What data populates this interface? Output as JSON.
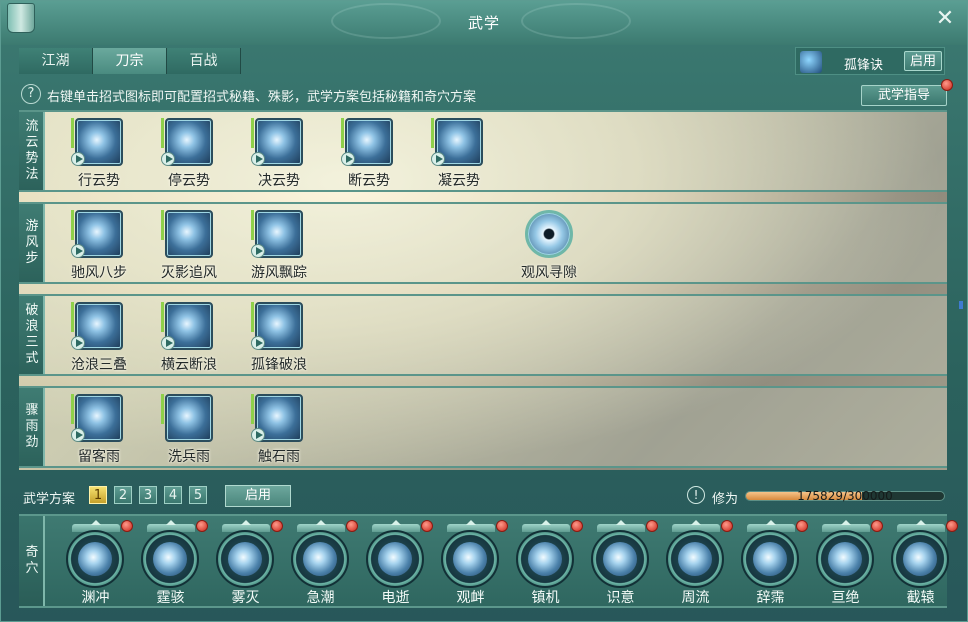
{
  "window": {
    "title": "武学"
  },
  "tabs": [
    {
      "label": "江湖",
      "active": false
    },
    {
      "label": "刀宗",
      "active": true
    },
    {
      "label": "百战",
      "active": false
    }
  ],
  "current_skill": {
    "name": "孤锋诀",
    "enable_label": "启用"
  },
  "hint": {
    "text": "右键单击招式图标即可配置招式秘籍、殊影，武学方案包括秘籍和奇穴方案"
  },
  "guide_button": {
    "label": "武学指导"
  },
  "categories": [
    {
      "label": [
        "流",
        "云",
        "势",
        "法"
      ],
      "moves": [
        {
          "name": "行云势",
          "kind": "square",
          "playable": true
        },
        {
          "name": "停云势",
          "kind": "square",
          "playable": true
        },
        {
          "name": "决云势",
          "kind": "square",
          "playable": true
        },
        {
          "name": "断云势",
          "kind": "square",
          "playable": true
        },
        {
          "name": "凝云势",
          "kind": "square",
          "playable": true
        }
      ]
    },
    {
      "label": [
        "游",
        "风",
        "步"
      ],
      "moves": [
        {
          "name": "驰风八步",
          "kind": "square",
          "playable": true
        },
        {
          "name": "灭影追风",
          "kind": "square",
          "playable": false
        },
        {
          "name": "游风飘踪",
          "kind": "square",
          "playable": true
        },
        {
          "name": "观风寻隙",
          "kind": "round",
          "playable": false
        }
      ]
    },
    {
      "label": [
        "破",
        "浪",
        "三",
        "式"
      ],
      "moves": [
        {
          "name": "沧浪三叠",
          "kind": "square",
          "playable": true
        },
        {
          "name": "横云断浪",
          "kind": "square",
          "playable": true
        },
        {
          "name": "孤锋破浪",
          "kind": "square",
          "playable": true
        }
      ]
    },
    {
      "label": [
        "骤",
        "雨",
        "劲"
      ],
      "moves": [
        {
          "name": "留客雨",
          "kind": "square",
          "playable": true
        },
        {
          "name": "洗兵雨",
          "kind": "square",
          "playable": false
        },
        {
          "name": "触石雨",
          "kind": "square",
          "playable": true
        }
      ]
    }
  ],
  "plan": {
    "label": "武学方案",
    "numbers": [
      "1",
      "2",
      "3",
      "4",
      "5"
    ],
    "active_index": 0,
    "enable_label": "启用"
  },
  "cultivation": {
    "icon": "exclamation-icon",
    "label": "修为",
    "text": "175829/300000",
    "progress": 0.586
  },
  "qixue": {
    "label": [
      "奇",
      "穴"
    ],
    "items": [
      "渊冲",
      "霆骇",
      "雾灭",
      "急潮",
      "电逝",
      "观衅",
      "镇机",
      "识意",
      "周流",
      "辞霈",
      "亘绝",
      "截辕"
    ]
  },
  "colors": {
    "accent": "#3c7a72",
    "alert_dot": "#c8261a",
    "progress": "#d88a3e"
  }
}
